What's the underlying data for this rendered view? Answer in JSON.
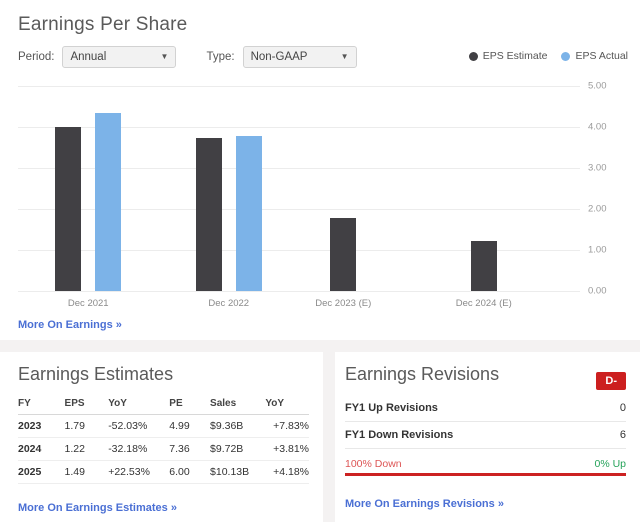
{
  "header": {
    "title": "Earnings Per Share",
    "period_label": "Period:",
    "period_value": "Annual",
    "type_label": "Type:",
    "type_value": "Non-GAAP",
    "caret_icon": "▼"
  },
  "chart_data": {
    "type": "bar",
    "title": "Earnings Per Share",
    "categories": [
      "Dec 2021",
      "Dec 2022",
      "Dec 2023 (E)",
      "Dec 2024 (E)"
    ],
    "series": [
      {
        "name": "EPS Estimate",
        "color": "#414044",
        "values": [
          4.0,
          3.72,
          1.79,
          1.22
        ]
      },
      {
        "name": "EPS Actual",
        "color": "#7cb3e8",
        "values": [
          4.35,
          3.78,
          null,
          null
        ]
      }
    ],
    "xlabel": "",
    "ylabel": "",
    "ylim": [
      0.0,
      5.0
    ],
    "yticks": [
      "0.00",
      "1.00",
      "2.00",
      "3.00",
      "4.00",
      "5.00"
    ],
    "grid": true,
    "legend_position": "top-right"
  },
  "chart_links": {
    "more_on_earnings": "More On Earnings »"
  },
  "estimates": {
    "title": "Earnings Estimates",
    "columns": [
      "FY",
      "EPS",
      "YoY",
      "PE",
      "Sales",
      "YoY"
    ],
    "rows": [
      {
        "fy": "2023",
        "eps": "1.79",
        "yoy": "-52.03%",
        "yoy_sign": "neg",
        "pe": "4.99",
        "sales": "$9.36B",
        "sales_yoy": "+7.83%",
        "sales_yoy_sign": "pos"
      },
      {
        "fy": "2024",
        "eps": "1.22",
        "yoy": "-32.18%",
        "yoy_sign": "neg",
        "pe": "7.36",
        "sales": "$9.72B",
        "sales_yoy": "+3.81%",
        "sales_yoy_sign": "pos"
      },
      {
        "fy": "2025",
        "eps": "1.49",
        "yoy": "+22.53%",
        "yoy_sign": "pos",
        "pe": "6.00",
        "sales": "$10.13B",
        "sales_yoy": "+4.18%",
        "sales_yoy_sign": "pos"
      }
    ],
    "more_link": "More On Earnings Estimates »"
  },
  "revisions": {
    "title": "Earnings Revisions",
    "grade": "D-",
    "grade_color": "#cc1f1f",
    "up_label": "FY1 Up Revisions",
    "up_value": "0",
    "down_label": "FY1 Down Revisions",
    "down_value": "6",
    "pct_down": "100% Down",
    "pct_up": "0% Up",
    "bar_down_pct": 100,
    "more_link": "More On Earnings Revisions »"
  }
}
